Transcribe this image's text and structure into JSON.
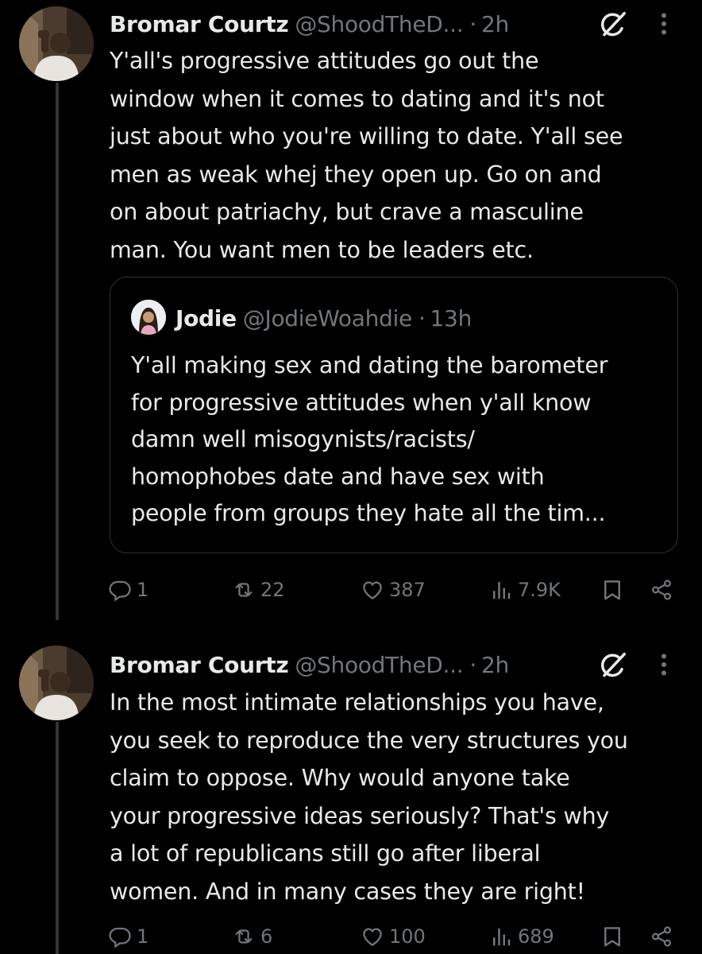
{
  "tweets": [
    {
      "author_name": "Bromar Courtz",
      "author_handle": "@ShoodTheD...",
      "separator": "·",
      "time": "2h",
      "lines": [
        "Y'all's progressive attitudes go out the",
        "window when it comes to dating and it's not",
        "just about who you're willing to date. Y'all see",
        "men as weak whej they open up. Go on and",
        "on about patriachy, but crave a masculine",
        "man. You want men to be leaders etc."
      ],
      "quote": {
        "author_name": "Jodie",
        "author_handle": "@JodieWoahdie",
        "separator": "·",
        "time": "13h",
        "lines": [
          "Y'all making sex and dating the barometer",
          "for progressive attitudes when y'all know",
          "damn well misogynists/racists/",
          "homophobes date and have sex with",
          "people from groups they hate all the tim..."
        ]
      },
      "stats": {
        "replies": "1",
        "reposts": "22",
        "likes": "387",
        "views": "7.9K"
      }
    },
    {
      "author_name": "Bromar Courtz",
      "author_handle": "@ShoodTheD...",
      "separator": "·",
      "time": "2h",
      "lines": [
        "In the most intimate relationships you have,",
        "you seek to reproduce the very structures you",
        "claim to oppose. Why would anyone take",
        "your progressive ideas seriously? That's why",
        "a lot of republicans still go after liberal",
        "women. And in many cases they are right!"
      ],
      "stats": {
        "replies": "1",
        "reposts": "6",
        "likes": "100",
        "views": "689"
      }
    }
  ],
  "icons": {
    "reply": "reply-icon",
    "repost": "repost-icon",
    "like": "heart-icon",
    "views": "views-icon",
    "bookmark": "bookmark-icon",
    "share": "share-icon",
    "grok": "grok-icon",
    "more": "more-icon"
  },
  "colors": {
    "background": "#000000",
    "text": "#e7e9ea",
    "secondary": "#71767b",
    "border": "#2f3336"
  }
}
